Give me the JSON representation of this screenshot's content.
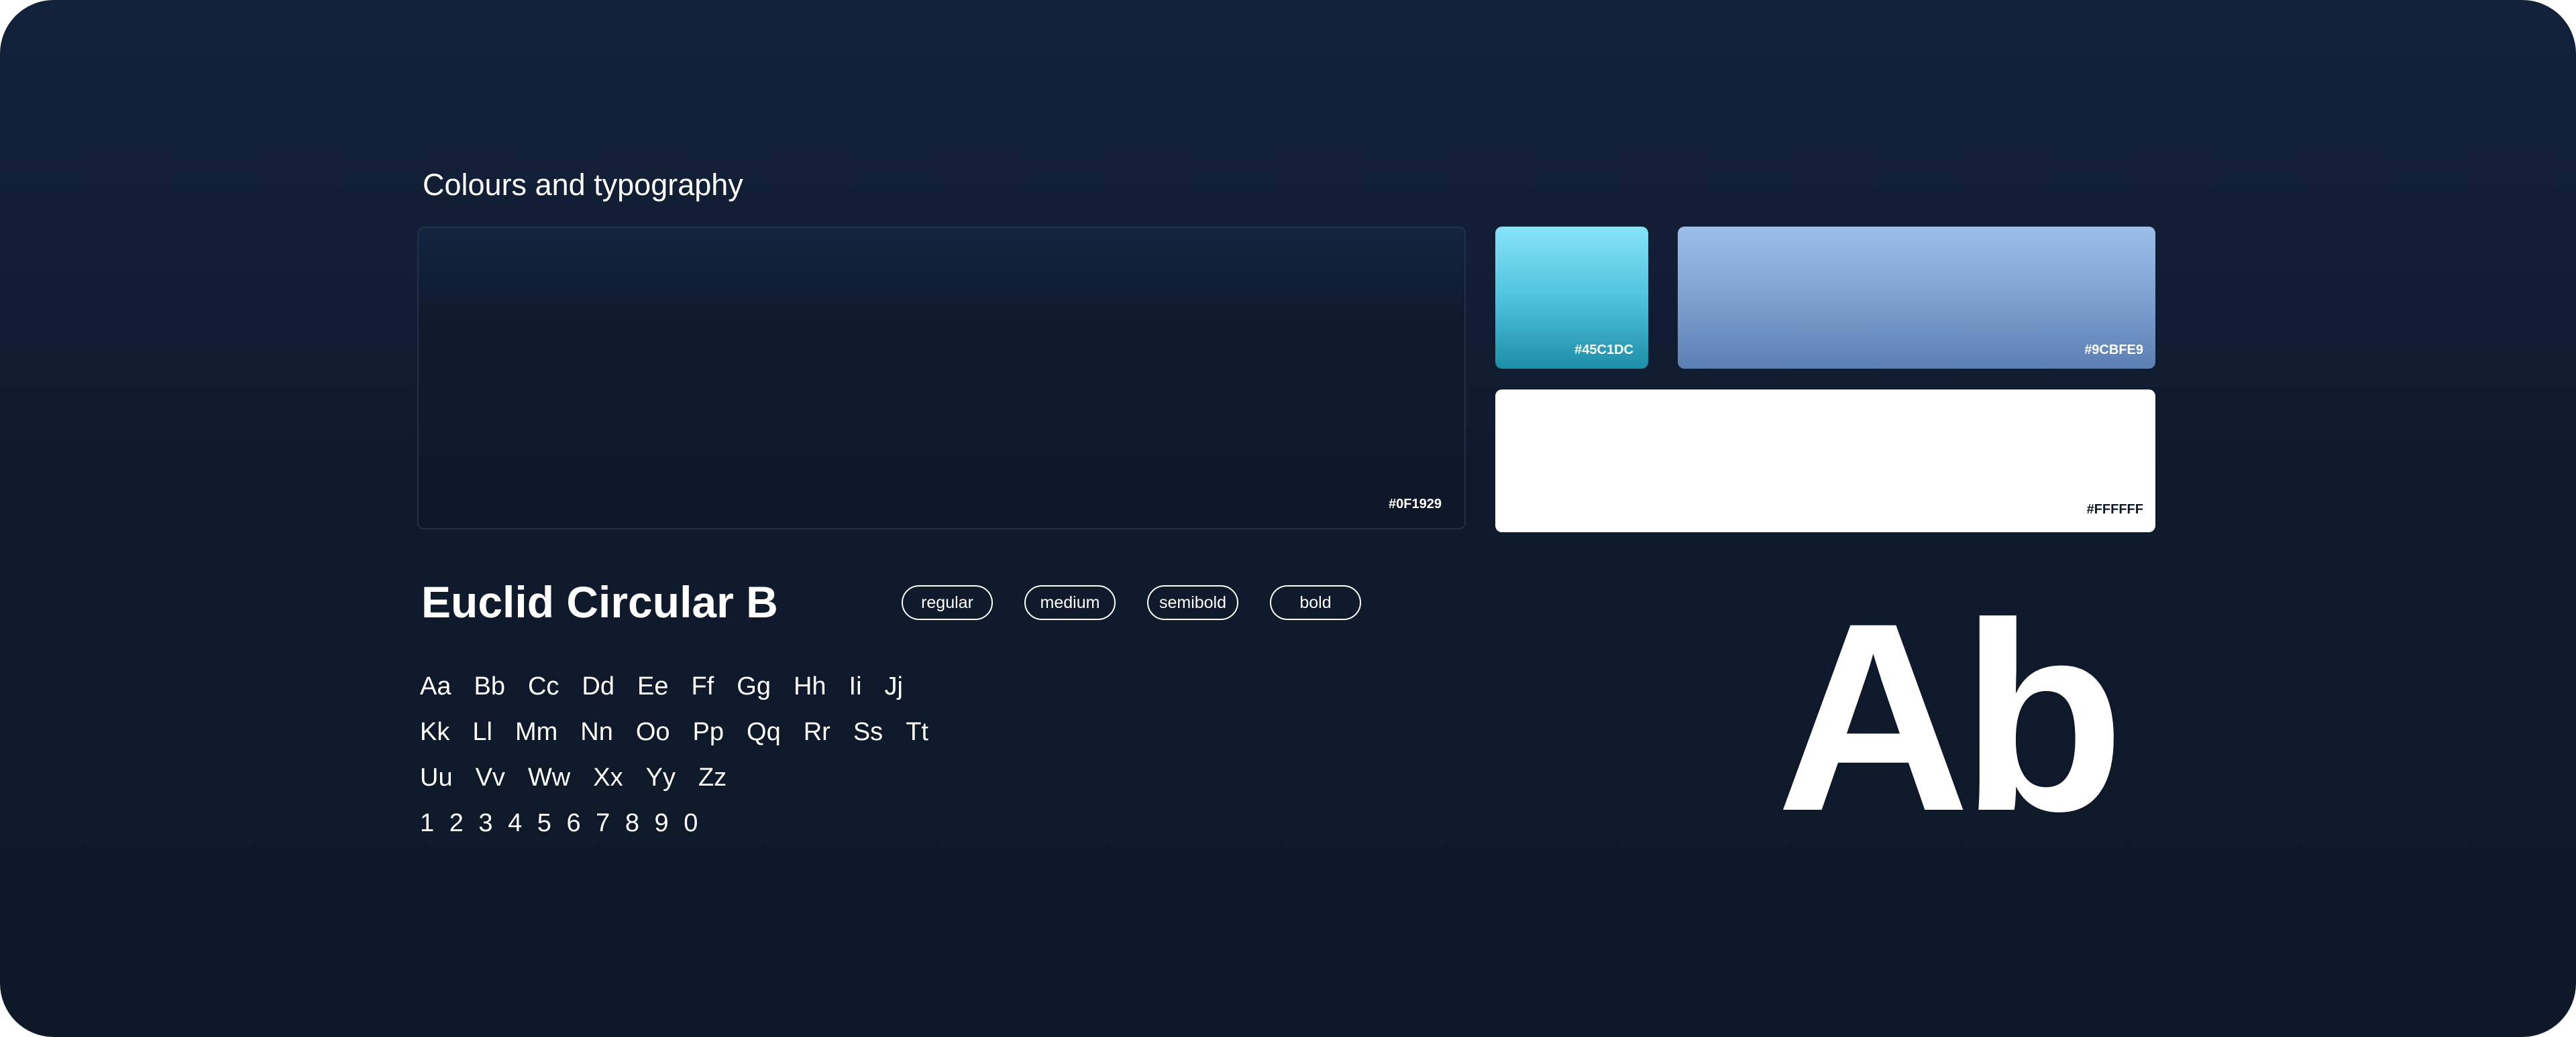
{
  "section": {
    "title": "Colours and typography"
  },
  "colors": {
    "dark": {
      "label": "#0F1929",
      "hex": "#0F1929"
    },
    "cyan": {
      "label": "#45C1DC",
      "hex": "#45C1DC"
    },
    "blue": {
      "label": "#9CBFE9",
      "hex": "#9CBFE9"
    },
    "white": {
      "label": "#FFFFFF",
      "hex": "#FFFFFF"
    }
  },
  "typography": {
    "font_name": "Euclid Circular B",
    "weights": [
      "regular",
      "medium",
      "semibold",
      "bold"
    ],
    "alphabet_rows": [
      [
        "Aa",
        "Bb",
        "Cc",
        "Dd",
        "Ee",
        "Ff",
        "Gg",
        "Hh",
        "Ii",
        "Jj"
      ],
      [
        "Kk",
        "Ll",
        "Mm",
        "Nn",
        "Oo",
        "Pp",
        "Qq",
        "Rr",
        "Ss",
        "Tt"
      ],
      [
        "Uu",
        "Vv",
        "Ww",
        "Xx",
        "Yy",
        "Zz"
      ]
    ],
    "digits": "1 2 3 4 5 6 7 8 9 0",
    "sample_glyph": "Ab"
  }
}
